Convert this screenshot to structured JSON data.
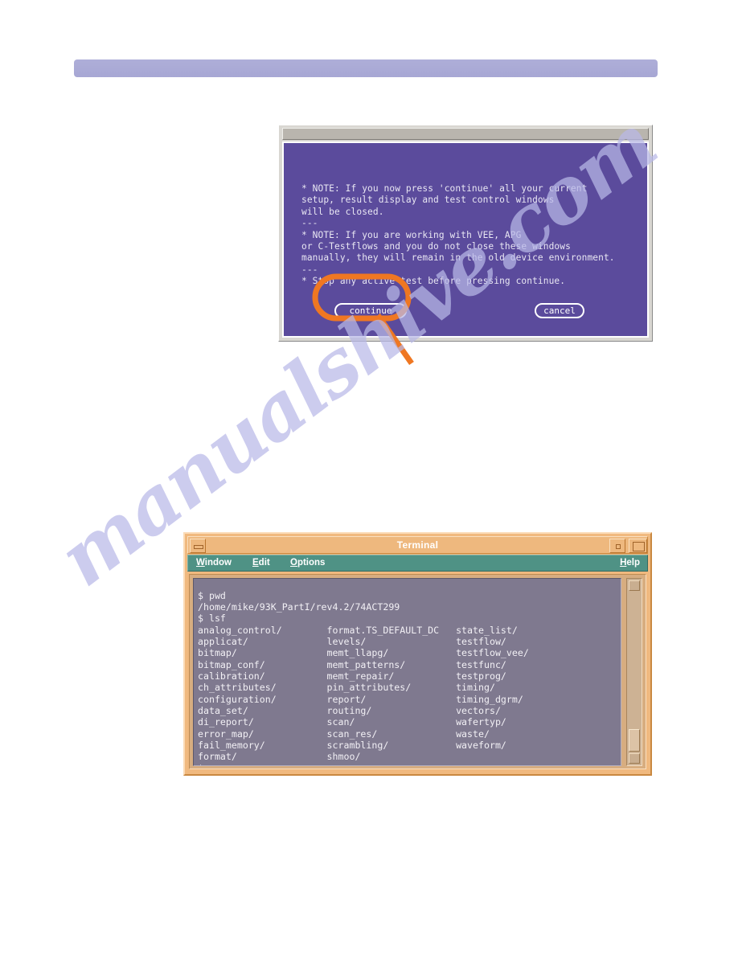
{
  "page": {
    "background_color": "#ffffff",
    "watermark_text": "manualshive.com",
    "watermark_color": "#b9b9e8"
  },
  "header_bar": {
    "label": "",
    "color": "#aeaed8"
  },
  "dialog": {
    "titlebar_label": "",
    "background_color": "#5b4b9c",
    "message": "* NOTE: If you now press 'continue' all your current\nsetup, result display and test control windows\nwill be closed.\n---\n* NOTE: If you are working with VEE, APG\nor C-Testflows and you do not close these windows\nmanually, they will remain in the old device environment.\n---\n* Stop any active test before pressing continue.",
    "buttons": {
      "continue_label": "continue",
      "cancel_label": "cancel"
    }
  },
  "callout": {
    "color": "#ef7722",
    "target": "continue-button",
    "shape": "rounded-rectangle-with-pointer-tail"
  },
  "terminal": {
    "title": "Terminal",
    "titlebar_color": "#eeb87e",
    "menubar_color": "#4f9285",
    "screen_color": "#7f798f",
    "window_buttons": {
      "minimize_label": "",
      "restore_label": "",
      "maximize_label": ""
    },
    "menu": {
      "window": {
        "mnemonic": "W",
        "rest": "indow"
      },
      "edit": {
        "mnemonic": "E",
        "rest": "dit"
      },
      "options": {
        "mnemonic": "O",
        "rest": "ptions"
      },
      "help": {
        "mnemonic": "H",
        "rest": "elp"
      }
    },
    "content": "$ pwd\n/home/mike/93K_PartI/rev4.2/74ACT299\n$ lsf\nanalog_control/        format.TS_DEFAULT_DC   state_list/\napplicat/              levels/                testflow/\nbitmap/                memt_llapg/            testflow_vee/\nbitmap_conf/           memt_patterns/         testfunc/\ncalibration/           memt_repair/           testprog/\nch_attributes/         pin_attributes/        timing/\nconfiguration/         report/                timing_dgrm/\ndata_set/              routing/               vectors/\ndi_report/             scan/                  wafertyp/\nerror_map/             scan_res/              waste/\nfail_memory/           scrambling/            waveform/\nformat/                shmoo/\n$",
    "prompt_lines": [
      "$ pwd",
      "/home/mike/93K_PartI/rev4.2/74ACT299",
      "$ lsf",
      "$"
    ],
    "directory_listing": {
      "column_1": [
        "analog_control/",
        "applicat/",
        "bitmap/",
        "bitmap_conf/",
        "calibration/",
        "ch_attributes/",
        "configuration/",
        "data_set/",
        "di_report/",
        "error_map/",
        "fail_memory/",
        "format/"
      ],
      "column_2": [
        "format.TS_DEFAULT_DC",
        "levels/",
        "memt_llapg/",
        "memt_patterns/",
        "memt_repair/",
        "pin_attributes/",
        "report/",
        "routing/",
        "scan/",
        "scan_res/",
        "scrambling/",
        "shmoo/"
      ],
      "column_3": [
        "state_list/",
        "testflow/",
        "testflow_vee/",
        "testfunc/",
        "testprog/",
        "timing/",
        "timing_dgrm/",
        "vectors/",
        "wafertyp/",
        "waste/",
        "waveform/"
      ]
    },
    "scrollbar": {
      "up_arrow": "△",
      "down_arrow": "▽"
    }
  }
}
